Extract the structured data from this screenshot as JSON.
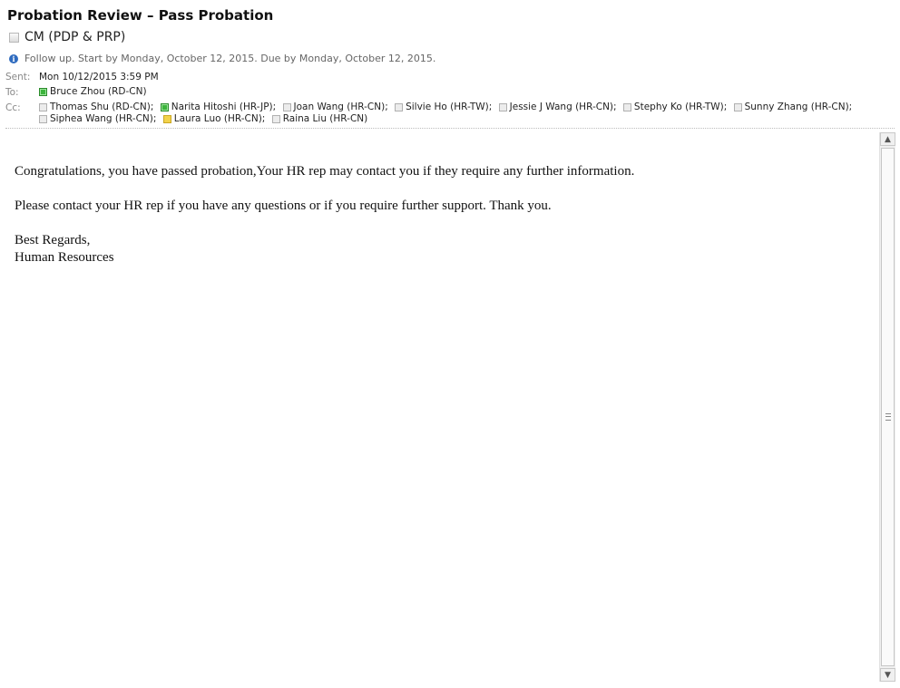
{
  "message": {
    "subject": "Probation Review – Pass Probation",
    "sender_name": "CM (PDP & PRP)",
    "follow_up": "Follow up.  Start by Monday, October 12, 2015.  Due by Monday, October 12, 2015.",
    "sent_label": "Sent:",
    "sent_value": "Mon 10/12/2015 3:59 PM",
    "to_label": "To:",
    "cc_label": "Cc:",
    "to": [
      {
        "name": "Bruce Zhou (RD-CN)",
        "presence": "available"
      }
    ],
    "cc_row1": [
      {
        "name": "Thomas Shu (RD-CN);",
        "presence": "unknown"
      },
      {
        "name": "Narita Hitoshi (HR-JP);",
        "presence": "available"
      },
      {
        "name": "Joan Wang (HR-CN);",
        "presence": "unknown"
      },
      {
        "name": "Silvie Ho (HR-TW);",
        "presence": "unknown"
      },
      {
        "name": "Jessie J Wang (HR-CN);",
        "presence": "unknown"
      },
      {
        "name": "Stephy Ko (HR-TW);",
        "presence": "unknown"
      },
      {
        "name": "Sunny Zhang (HR-CN);",
        "presence": "unknown"
      }
    ],
    "cc_row2": [
      {
        "name": "Siphea Wang (HR-CN);",
        "presence": "unknown"
      },
      {
        "name": "Laura Luo (HR-CN);",
        "presence": "away"
      },
      {
        "name": "Raina Liu (HR-CN)",
        "presence": "unknown"
      }
    ],
    "body": {
      "p1": "Congratulations, you have passed probation,Your HR rep may contact you if they require any further information.",
      "p2": "Please contact your HR rep if you have any questions or if you require further support. Thank you.",
      "closing": "Best Regards,",
      "signature": "Human Resources"
    }
  },
  "colors": {
    "presence_available": "#3cb43c",
    "presence_away": "#f2d24b",
    "presence_unknown": "#ececec",
    "info_icon": "#2f6bbf"
  },
  "icons": {
    "info": "info-icon",
    "scroll_up": "scroll-up-arrow-icon",
    "scroll_down": "scroll-down-arrow-icon"
  }
}
